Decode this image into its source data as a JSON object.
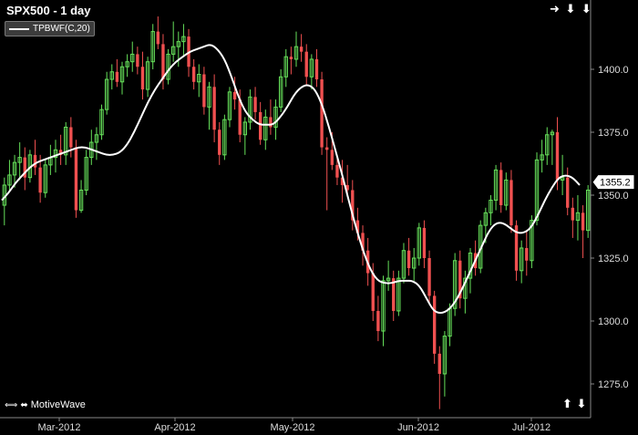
{
  "header": {
    "title": "SPX500 - 1 day"
  },
  "legend": {
    "label": "TPBWF(C,20)"
  },
  "nav": {
    "right_arrow": "➜",
    "down_arrow_1": "⬇",
    "down_arrow_2": "⬇"
  },
  "footer": {
    "brand": "MotiveWave",
    "left_arrow": "⟺",
    "right_arrows": "⬌",
    "up_arrow": "⬆",
    "down_arrow": "⬇"
  },
  "colors": {
    "up": "#66e05a",
    "down": "#f05050",
    "line": "#ffffff",
    "grid": "#333333",
    "axis": "#888888",
    "price_tag": "#ffffff"
  },
  "chart_data": {
    "type": "candlestick",
    "title": "SPX500 - 1 day",
    "y_axis": {
      "position": "right",
      "ticks": [
        1275.0,
        1300.0,
        1325.0,
        1350.0,
        1375.0,
        1400.0
      ],
      "tick_labels": [
        "1275.0",
        "1300.0",
        "1325.0",
        "1350.0",
        "1375.0",
        "1400.0"
      ],
      "ylim": [
        1263,
        1425
      ]
    },
    "x_axis": {
      "tick_labels": [
        "Mar-2012",
        "Apr-2012",
        "May-2012",
        "Jun-2012",
        "Jul-2012"
      ]
    },
    "last_price_label": "1355.2",
    "candles": [
      {
        "o": 1346,
        "h": 1357,
        "l": 1338,
        "c": 1354
      },
      {
        "o": 1354,
        "h": 1364,
        "l": 1352,
        "c": 1358
      },
      {
        "o": 1358,
        "h": 1366,
        "l": 1353,
        "c": 1363
      },
      {
        "o": 1363,
        "h": 1371,
        "l": 1356,
        "c": 1365
      },
      {
        "o": 1365,
        "h": 1369,
        "l": 1352,
        "c": 1357
      },
      {
        "o": 1357,
        "h": 1368,
        "l": 1355,
        "c": 1366
      },
      {
        "o": 1366,
        "h": 1372,
        "l": 1358,
        "c": 1361
      },
      {
        "o": 1361,
        "h": 1366,
        "l": 1347,
        "c": 1351
      },
      {
        "o": 1351,
        "h": 1364,
        "l": 1349,
        "c": 1362
      },
      {
        "o": 1362,
        "h": 1370,
        "l": 1358,
        "c": 1365
      },
      {
        "o": 1365,
        "h": 1372,
        "l": 1359,
        "c": 1368
      },
      {
        "o": 1368,
        "h": 1374,
        "l": 1362,
        "c": 1366
      },
      {
        "o": 1366,
        "h": 1379,
        "l": 1362,
        "c": 1377
      },
      {
        "o": 1377,
        "h": 1381,
        "l": 1365,
        "c": 1369
      },
      {
        "o": 1369,
        "h": 1372,
        "l": 1341,
        "c": 1344
      },
      {
        "o": 1344,
        "h": 1356,
        "l": 1343,
        "c": 1352
      },
      {
        "o": 1352,
        "h": 1368,
        "l": 1350,
        "c": 1365
      },
      {
        "o": 1365,
        "h": 1376,
        "l": 1362,
        "c": 1371
      },
      {
        "o": 1371,
        "h": 1377,
        "l": 1364,
        "c": 1374
      },
      {
        "o": 1374,
        "h": 1386,
        "l": 1372,
        "c": 1384
      },
      {
        "o": 1384,
        "h": 1399,
        "l": 1382,
        "c": 1396
      },
      {
        "o": 1396,
        "h": 1402,
        "l": 1392,
        "c": 1399
      },
      {
        "o": 1399,
        "h": 1404,
        "l": 1393,
        "c": 1395
      },
      {
        "o": 1395,
        "h": 1403,
        "l": 1390,
        "c": 1401
      },
      {
        "o": 1401,
        "h": 1406,
        "l": 1397,
        "c": 1403
      },
      {
        "o": 1403,
        "h": 1411,
        "l": 1399,
        "c": 1406
      },
      {
        "o": 1406,
        "h": 1409,
        "l": 1398,
        "c": 1401
      },
      {
        "o": 1401,
        "h": 1407,
        "l": 1388,
        "c": 1392
      },
      {
        "o": 1392,
        "h": 1405,
        "l": 1389,
        "c": 1403
      },
      {
        "o": 1403,
        "h": 1418,
        "l": 1400,
        "c": 1415
      },
      {
        "o": 1415,
        "h": 1421,
        "l": 1408,
        "c": 1410
      },
      {
        "o": 1410,
        "h": 1414,
        "l": 1392,
        "c": 1396
      },
      {
        "o": 1396,
        "h": 1408,
        "l": 1394,
        "c": 1406
      },
      {
        "o": 1406,
        "h": 1419,
        "l": 1403,
        "c": 1409
      },
      {
        "o": 1409,
        "h": 1415,
        "l": 1401,
        "c": 1411
      },
      {
        "o": 1411,
        "h": 1418,
        "l": 1405,
        "c": 1413
      },
      {
        "o": 1413,
        "h": 1416,
        "l": 1397,
        "c": 1401
      },
      {
        "o": 1401,
        "h": 1404,
        "l": 1392,
        "c": 1395
      },
      {
        "o": 1395,
        "h": 1402,
        "l": 1389,
        "c": 1398
      },
      {
        "o": 1398,
        "h": 1401,
        "l": 1382,
        "c": 1385
      },
      {
        "o": 1385,
        "h": 1395,
        "l": 1376,
        "c": 1393
      },
      {
        "o": 1393,
        "h": 1398,
        "l": 1371,
        "c": 1376
      },
      {
        "o": 1376,
        "h": 1379,
        "l": 1362,
        "c": 1366
      },
      {
        "o": 1366,
        "h": 1382,
        "l": 1364,
        "c": 1380
      },
      {
        "o": 1380,
        "h": 1393,
        "l": 1377,
        "c": 1391
      },
      {
        "o": 1391,
        "h": 1397,
        "l": 1384,
        "c": 1388
      },
      {
        "o": 1388,
        "h": 1392,
        "l": 1371,
        "c": 1374
      },
      {
        "o": 1374,
        "h": 1381,
        "l": 1366,
        "c": 1379
      },
      {
        "o": 1379,
        "h": 1392,
        "l": 1376,
        "c": 1389
      },
      {
        "o": 1389,
        "h": 1393,
        "l": 1380,
        "c": 1383
      },
      {
        "o": 1383,
        "h": 1387,
        "l": 1370,
        "c": 1372
      },
      {
        "o": 1372,
        "h": 1384,
        "l": 1368,
        "c": 1381
      },
      {
        "o": 1381,
        "h": 1388,
        "l": 1374,
        "c": 1377
      },
      {
        "o": 1377,
        "h": 1388,
        "l": 1372,
        "c": 1385
      },
      {
        "o": 1385,
        "h": 1400,
        "l": 1383,
        "c": 1397
      },
      {
        "o": 1397,
        "h": 1408,
        "l": 1393,
        "c": 1405
      },
      {
        "o": 1405,
        "h": 1409,
        "l": 1398,
        "c": 1404
      },
      {
        "o": 1404,
        "h": 1415,
        "l": 1401,
        "c": 1409
      },
      {
        "o": 1409,
        "h": 1414,
        "l": 1403,
        "c": 1407
      },
      {
        "o": 1407,
        "h": 1410,
        "l": 1394,
        "c": 1397
      },
      {
        "o": 1397,
        "h": 1406,
        "l": 1392,
        "c": 1404
      },
      {
        "o": 1404,
        "h": 1408,
        "l": 1393,
        "c": 1396
      },
      {
        "o": 1396,
        "h": 1399,
        "l": 1366,
        "c": 1369
      },
      {
        "o": 1369,
        "h": 1373,
        "l": 1344,
        "c": 1368
      },
      {
        "o": 1368,
        "h": 1375,
        "l": 1360,
        "c": 1362
      },
      {
        "o": 1362,
        "h": 1366,
        "l": 1354,
        "c": 1357
      },
      {
        "o": 1357,
        "h": 1364,
        "l": 1347,
        "c": 1354
      },
      {
        "o": 1354,
        "h": 1362,
        "l": 1350,
        "c": 1352
      },
      {
        "o": 1352,
        "h": 1356,
        "l": 1336,
        "c": 1340
      },
      {
        "o": 1340,
        "h": 1345,
        "l": 1332,
        "c": 1335
      },
      {
        "o": 1335,
        "h": 1338,
        "l": 1322,
        "c": 1328
      },
      {
        "o": 1328,
        "h": 1333,
        "l": 1314,
        "c": 1319
      },
      {
        "o": 1319,
        "h": 1323,
        "l": 1300,
        "c": 1304
      },
      {
        "o": 1304,
        "h": 1310,
        "l": 1292,
        "c": 1296
      },
      {
        "o": 1296,
        "h": 1318,
        "l": 1290,
        "c": 1316
      },
      {
        "o": 1316,
        "h": 1324,
        "l": 1312,
        "c": 1317
      },
      {
        "o": 1317,
        "h": 1320,
        "l": 1300,
        "c": 1304
      },
      {
        "o": 1304,
        "h": 1320,
        "l": 1302,
        "c": 1317
      },
      {
        "o": 1317,
        "h": 1331,
        "l": 1315,
        "c": 1328
      },
      {
        "o": 1328,
        "h": 1333,
        "l": 1318,
        "c": 1321
      },
      {
        "o": 1321,
        "h": 1329,
        "l": 1316,
        "c": 1325
      },
      {
        "o": 1325,
        "h": 1339,
        "l": 1322,
        "c": 1337
      },
      {
        "o": 1337,
        "h": 1340,
        "l": 1321,
        "c": 1325
      },
      {
        "o": 1325,
        "h": 1328,
        "l": 1307,
        "c": 1310
      },
      {
        "o": 1310,
        "h": 1312,
        "l": 1283,
        "c": 1287
      },
      {
        "o": 1287,
        "h": 1290,
        "l": 1265,
        "c": 1279
      },
      {
        "o": 1279,
        "h": 1296,
        "l": 1270,
        "c": 1294
      },
      {
        "o": 1294,
        "h": 1307,
        "l": 1290,
        "c": 1305
      },
      {
        "o": 1305,
        "h": 1327,
        "l": 1302,
        "c": 1324
      },
      {
        "o": 1324,
        "h": 1328,
        "l": 1305,
        "c": 1309
      },
      {
        "o": 1309,
        "h": 1320,
        "l": 1303,
        "c": 1317
      },
      {
        "o": 1317,
        "h": 1329,
        "l": 1311,
        "c": 1327
      },
      {
        "o": 1327,
        "h": 1332,
        "l": 1318,
        "c": 1321
      },
      {
        "o": 1321,
        "h": 1340,
        "l": 1319,
        "c": 1338
      },
      {
        "o": 1338,
        "h": 1345,
        "l": 1331,
        "c": 1343
      },
      {
        "o": 1343,
        "h": 1350,
        "l": 1338,
        "c": 1348
      },
      {
        "o": 1348,
        "h": 1362,
        "l": 1344,
        "c": 1360
      },
      {
        "o": 1360,
        "h": 1363,
        "l": 1343,
        "c": 1346
      },
      {
        "o": 1346,
        "h": 1359,
        "l": 1344,
        "c": 1356
      },
      {
        "o": 1356,
        "h": 1360,
        "l": 1335,
        "c": 1338
      },
      {
        "o": 1338,
        "h": 1340,
        "l": 1316,
        "c": 1320
      },
      {
        "o": 1320,
        "h": 1332,
        "l": 1315,
        "c": 1329
      },
      {
        "o": 1329,
        "h": 1336,
        "l": 1318,
        "c": 1324
      },
      {
        "o": 1324,
        "h": 1342,
        "l": 1321,
        "c": 1340
      },
      {
        "o": 1340,
        "h": 1367,
        "l": 1338,
        "c": 1364
      },
      {
        "o": 1364,
        "h": 1372,
        "l": 1359,
        "c": 1366
      },
      {
        "o": 1366,
        "h": 1377,
        "l": 1362,
        "c": 1374
      },
      {
        "o": 1374,
        "h": 1376,
        "l": 1362,
        "c": 1375
      },
      {
        "o": 1375,
        "h": 1381,
        "l": 1352,
        "c": 1356
      },
      {
        "o": 1356,
        "h": 1366,
        "l": 1350,
        "c": 1357
      },
      {
        "o": 1357,
        "h": 1361,
        "l": 1342,
        "c": 1345
      },
      {
        "o": 1345,
        "h": 1349,
        "l": 1333,
        "c": 1340
      },
      {
        "o": 1340,
        "h": 1350,
        "l": 1332,
        "c": 1343
      },
      {
        "o": 1343,
        "h": 1346,
        "l": 1325,
        "c": 1336
      },
      {
        "o": 1336,
        "h": 1354,
        "l": 1333,
        "c": 1352
      }
    ],
    "series": [
      {
        "name": "TPBWF(C,20)",
        "values": [
          1348,
          1351,
          1355,
          1358,
          1361,
          1363,
          1364,
          1365,
          1366,
          1367,
          1368,
          1369,
          1369,
          1368,
          1367,
          1366,
          1366,
          1367,
          1370,
          1375,
          1381,
          1387,
          1392,
          1396,
          1400,
          1403,
          1405,
          1407,
          1408,
          1409,
          1410,
          1408,
          1404,
          1397,
          1389,
          1383,
          1380,
          1378,
          1378,
          1378,
          1381,
          1385,
          1390,
          1393,
          1394,
          1392,
          1386,
          1377,
          1367,
          1357,
          1346,
          1336,
          1327,
          1320,
          1316,
          1315,
          1315,
          1316,
          1316,
          1316,
          1314,
          1309,
          1304,
          1303,
          1304,
          1307,
          1312,
          1318,
          1324,
          1330,
          1336,
          1339,
          1339,
          1337,
          1335,
          1335,
          1337,
          1342,
          1348,
          1353,
          1357,
          1358,
          1357,
          1354
        ]
      }
    ]
  }
}
